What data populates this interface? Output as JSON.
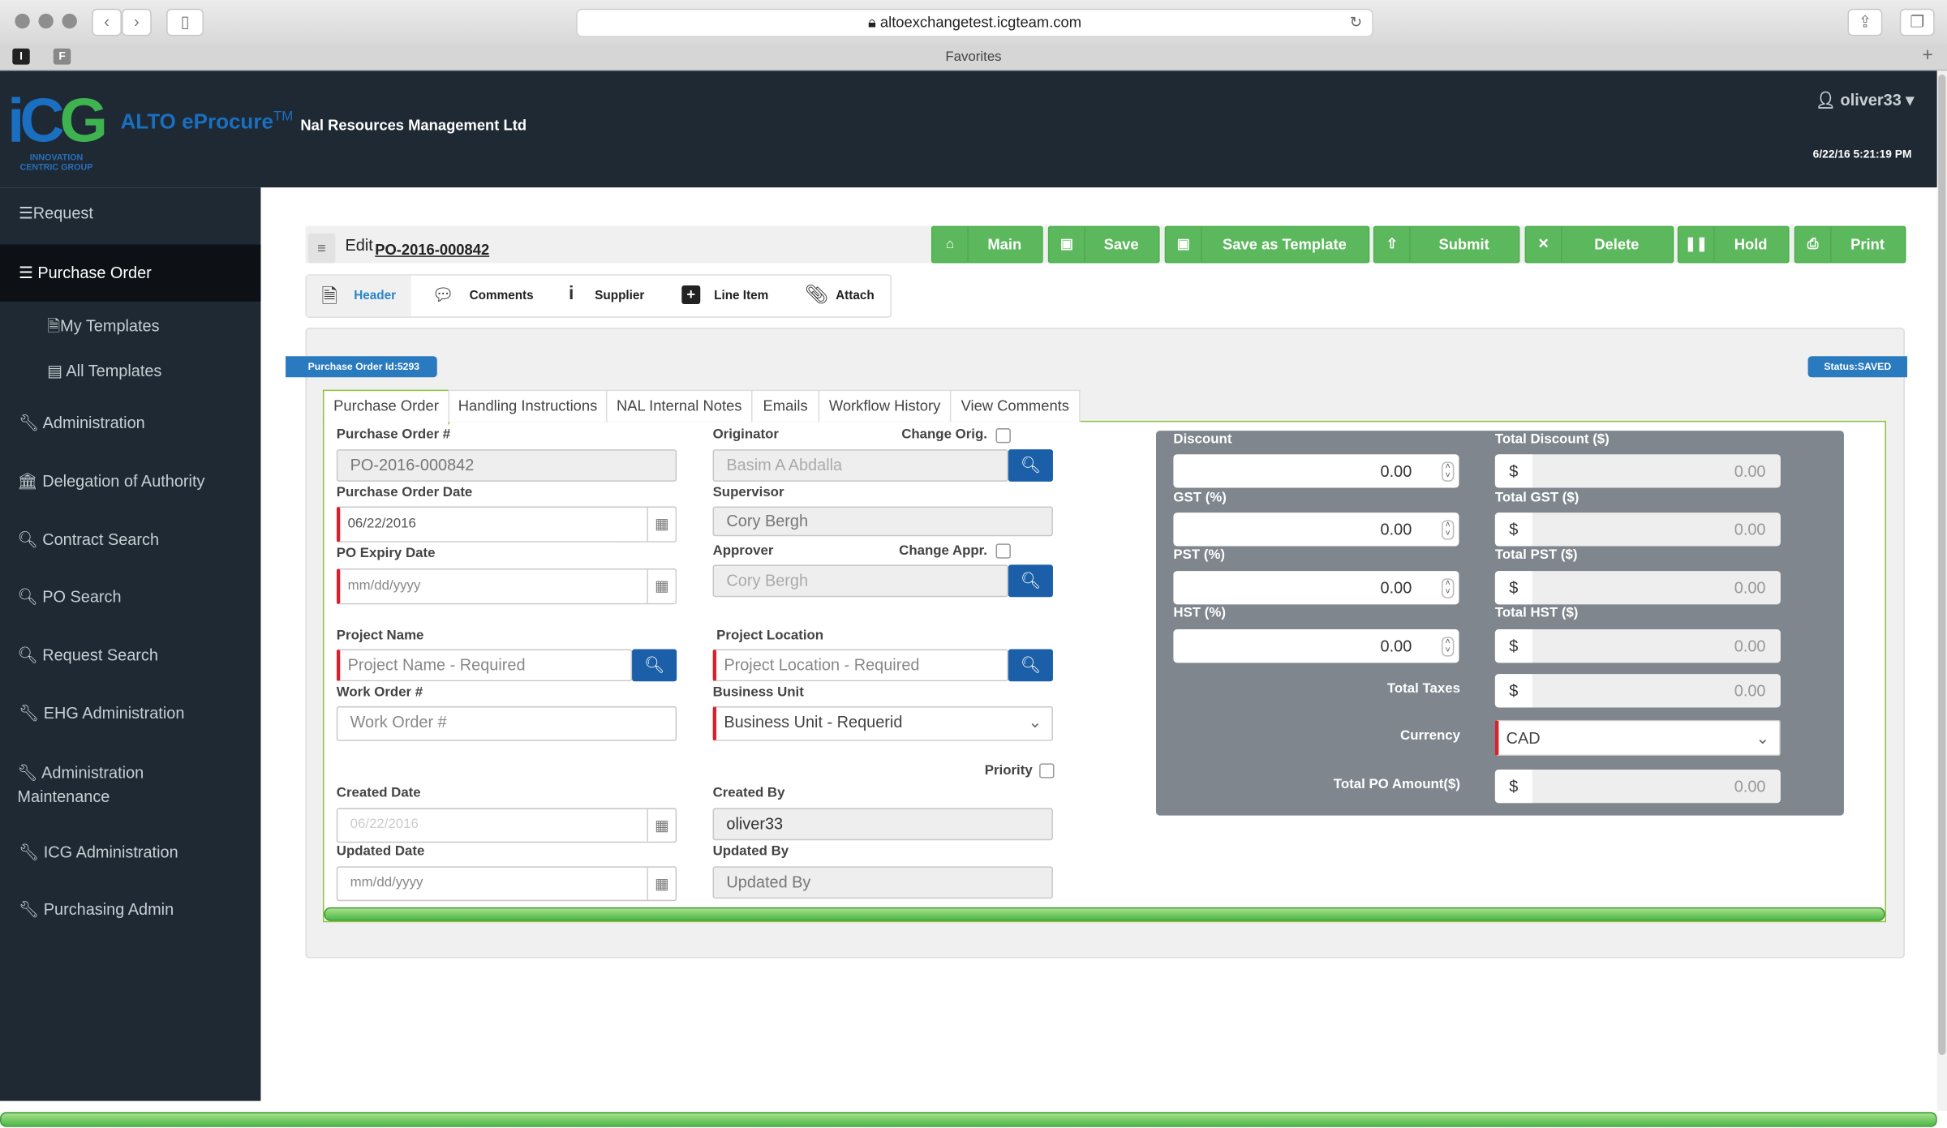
{
  "browser": {
    "url": "altoexchangetest.icgteam.com",
    "favorites": "Favorites",
    "tab_icons": [
      "I",
      "F"
    ]
  },
  "header": {
    "logo_text": "iCG",
    "logo_sub1": "INNOVATION",
    "logo_sub2": "CENTRIC GROUP",
    "product": "ALTO eProcure",
    "tm": "TM",
    "company": "Nal Resources Management Ltd",
    "user": "oliver33",
    "datetime": "6/22/16 5:21:19 PM"
  },
  "sidebar": {
    "items": [
      {
        "label": "Request",
        "icon": "list-icon"
      },
      {
        "label": "Purchase Order",
        "icon": "list-icon",
        "active": true
      },
      {
        "label": "My Templates",
        "icon": "file-icon"
      },
      {
        "label": "All Templates",
        "icon": "list-icon"
      },
      {
        "label": "Administration",
        "icon": "wrench-icon"
      },
      {
        "label": "Delegation of Authority",
        "icon": "bank-icon"
      },
      {
        "label": "Contract Search",
        "icon": "search-icon"
      },
      {
        "label": "PO Search",
        "icon": "search-icon"
      },
      {
        "label": "Request Search",
        "icon": "search-icon"
      },
      {
        "label": "EHG Administration",
        "icon": "wrench-icon"
      },
      {
        "label": "Administration Maintenance",
        "icon": "wrench-icon"
      },
      {
        "label": "ICG Administration",
        "icon": "wrench-icon"
      },
      {
        "label": "Purchasing Admin",
        "icon": "wrench-icon"
      }
    ]
  },
  "toolbar": {
    "edit": "Edit",
    "po_number": "PO-2016-000842",
    "buttons": [
      "Main",
      "Save",
      "Save as Template",
      "Submit",
      "Delete",
      "Hold",
      "Print"
    ]
  },
  "steps": [
    "Header",
    "Comments",
    "Supplier",
    "Line Item",
    "Attach"
  ],
  "badges": {
    "po_id": "Purchase Order Id:5293",
    "status": "Status:SAVED"
  },
  "tabs": [
    "Purchase Order",
    "Handling Instructions",
    "NAL Internal Notes",
    "Emails",
    "Workflow History",
    "View Comments"
  ],
  "form": {
    "po_number": {
      "label": "Purchase Order #",
      "value": "PO-2016-000842"
    },
    "po_date": {
      "label": "Purchase Order Date",
      "value": "06/22/2016"
    },
    "po_expiry": {
      "label": "PO Expiry Date",
      "placeholder": "mm/dd/yyyy"
    },
    "project_name": {
      "label": "Project Name",
      "placeholder": "Project Name - Required"
    },
    "work_order": {
      "label": "Work Order #",
      "placeholder": "Work Order #"
    },
    "created_date": {
      "label": "Created Date",
      "value": "06/22/2016"
    },
    "updated_date": {
      "label": "Updated Date",
      "placeholder": "mm/dd/yyyy"
    },
    "originator": {
      "label": "Originator",
      "value": "Basim A Abdalla",
      "change": "Change Orig."
    },
    "supervisor": {
      "label": "Supervisor",
      "value": "Cory Bergh"
    },
    "approver": {
      "label": "Approver",
      "value": "Cory Bergh",
      "change": "Change Appr."
    },
    "project_location": {
      "label": "Project Location",
      "placeholder": "Project Location - Required"
    },
    "business_unit": {
      "label": "Business Unit",
      "value": "Business Unit - Requerid"
    },
    "priority": {
      "label": "Priority"
    },
    "created_by": {
      "label": "Created By",
      "value": "oliver33"
    },
    "updated_by": {
      "label": "Updated By",
      "placeholder": "Updated By"
    }
  },
  "totals": {
    "discount": {
      "label": "Discount",
      "value": "0.00"
    },
    "gst": {
      "label": "GST (%)",
      "value": "0.00"
    },
    "pst": {
      "label": "PST (%)",
      "value": "0.00"
    },
    "hst": {
      "label": "HST (%)",
      "value": "0.00"
    },
    "total_discount": {
      "label": "Total Discount ($)",
      "value": "0.00"
    },
    "total_gst": {
      "label": "Total GST ($)",
      "value": "0.00"
    },
    "total_pst": {
      "label": "Total PST ($)",
      "value": "0.00"
    },
    "total_hst": {
      "label": "Total HST ($)",
      "value": "0.00"
    },
    "total_taxes": {
      "label": "Total Taxes",
      "value": "0.00"
    },
    "currency": {
      "label": "Currency",
      "value": "CAD"
    },
    "total_po": {
      "label": "Total PO Amount($)",
      "value": "0.00"
    },
    "currency_symbol": "$"
  },
  "colors": {
    "sidebar": "#1e2934",
    "primary": "#1a5fa8",
    "success": "#5cb85c",
    "required": "#d9202b",
    "panel": "#7f868d"
  }
}
